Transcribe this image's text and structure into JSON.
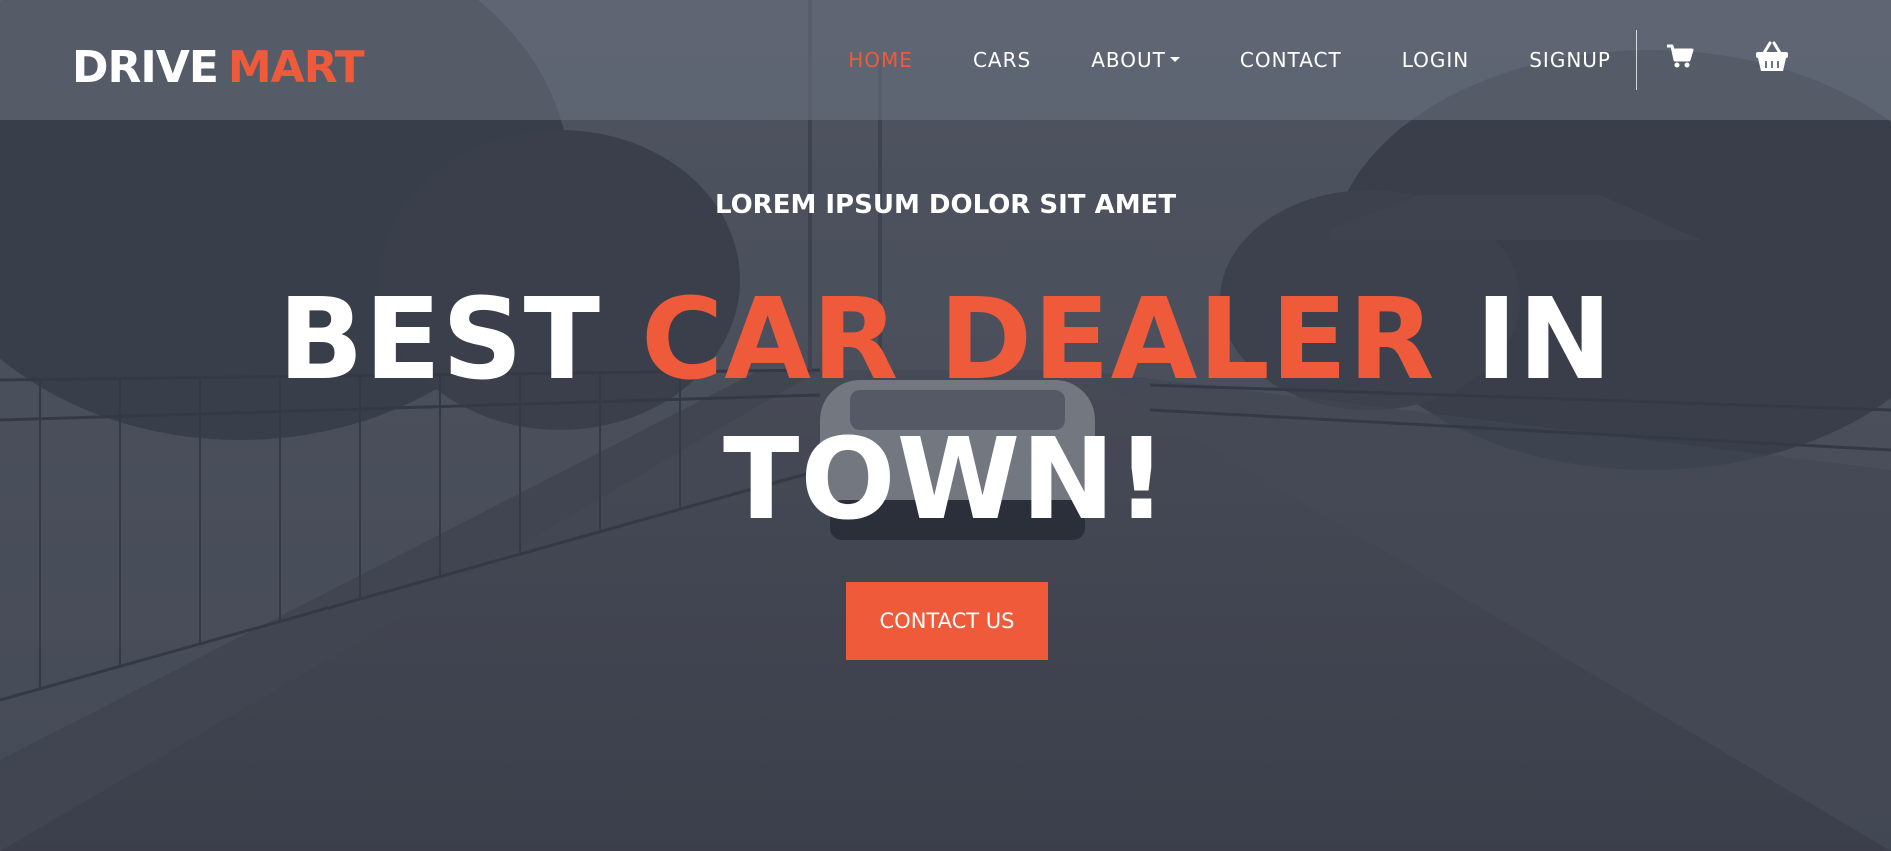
{
  "brand": {
    "part1": "DRIVE",
    "part2": "MART"
  },
  "nav": {
    "items": [
      {
        "label": "HOME",
        "active": true
      },
      {
        "label": "CARS",
        "active": false
      },
      {
        "label": "ABOUT",
        "active": false,
        "dropdown": true
      },
      {
        "label": "CONTACT",
        "active": false
      },
      {
        "label": "LOGIN",
        "active": false
      },
      {
        "label": "SIGNUP",
        "active": false
      }
    ],
    "icons": [
      "cart-icon",
      "basket-icon"
    ]
  },
  "hero": {
    "eyebrow": "LOREM IPSUM DOLOR SIT AMET",
    "headline_part1": "BEST",
    "headline_highlight": "CAR DEALER",
    "headline_part2": "IN",
    "headline_line2": "TOWN!",
    "cta_label": "CONTACT US"
  },
  "colors": {
    "accent": "#ee5a3a",
    "text": "#ffffff",
    "overlay": "#3b3f4b"
  }
}
